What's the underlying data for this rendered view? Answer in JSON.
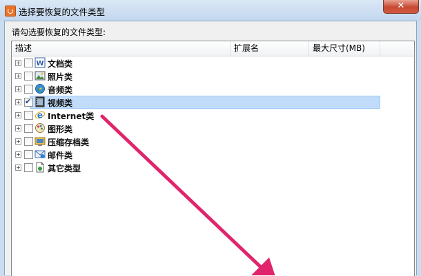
{
  "window": {
    "title": "选择要恢复的文件类型",
    "close_glyph": "✕"
  },
  "prompt": "请勾选要恢复的文件类型:",
  "columns": {
    "desc": "描述",
    "ext": "扩展名",
    "maxsize": "最大尺寸(MB)"
  },
  "rows": [
    {
      "label": "文档类",
      "icon": "word-document-icon",
      "checked": false
    },
    {
      "label": "照片类",
      "icon": "photo-icon",
      "checked": false
    },
    {
      "label": "音频类",
      "icon": "audio-icon",
      "checked": false
    },
    {
      "label": "视频类",
      "icon": "video-icon",
      "checked": true,
      "selected": true
    },
    {
      "label": "Internet类",
      "icon": "internet-explorer-icon",
      "checked": false
    },
    {
      "label": "图形类",
      "icon": "graphics-icon",
      "checked": false
    },
    {
      "label": "压缩存档类",
      "icon": "archive-icon",
      "checked": false
    },
    {
      "label": "邮件类",
      "icon": "mail-icon",
      "checked": false
    },
    {
      "label": "其它类型",
      "icon": "other-file-icon",
      "checked": false
    }
  ],
  "colors": {
    "selection": "#c1dcfb",
    "annotation_arrow": "#e0256c"
  }
}
